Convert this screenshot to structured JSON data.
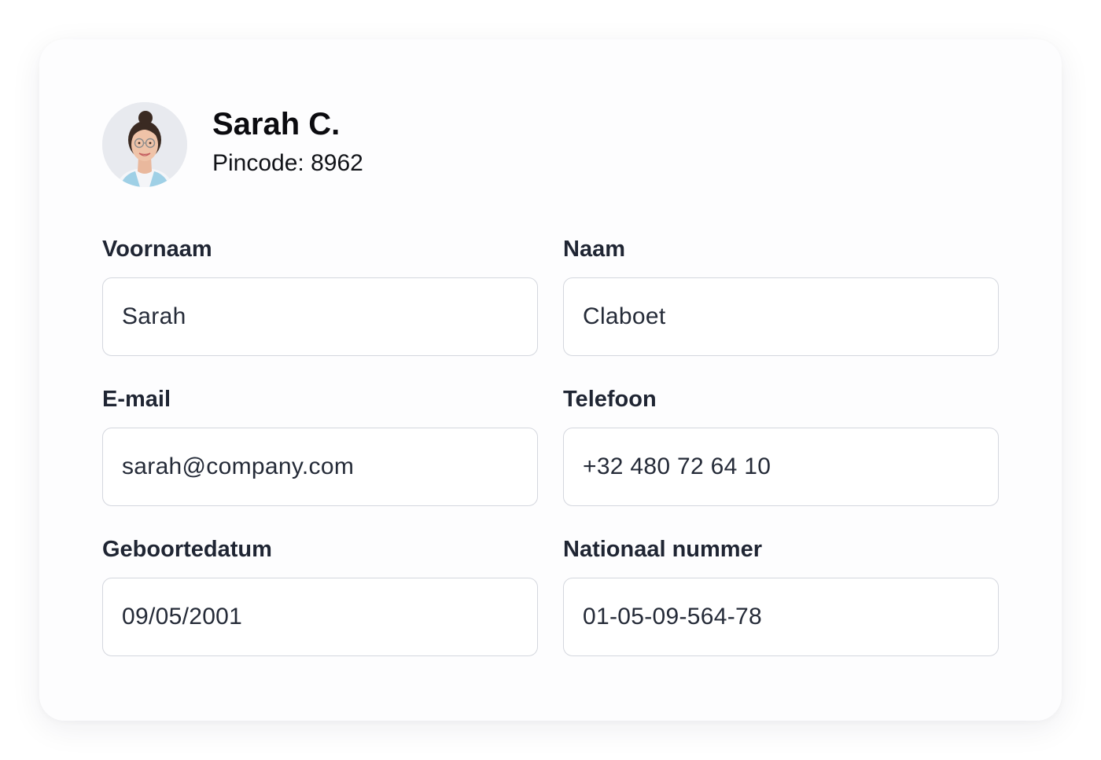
{
  "profile": {
    "name": "Sarah C.",
    "pincode_label": "Pincode: 8962",
    "avatar_icon": "user-photo"
  },
  "form": {
    "fields": [
      {
        "label": "Voornaam",
        "value": "Sarah"
      },
      {
        "label": "Naam",
        "value": "Claboet"
      },
      {
        "label": "E-mail",
        "value": "sarah@company.com"
      },
      {
        "label": "Telefoon",
        "value": "+32 480 72 64 10"
      },
      {
        "label": "Geboortedatum",
        "value": "09/05/2001"
      },
      {
        "label": "Nationaal nummer",
        "value": "01-05-09-564-78"
      }
    ]
  },
  "colors": {
    "card_background": "#fdfdfe",
    "label_text": "#1f2533",
    "input_border": "#d4d7de",
    "input_text": "#252b38"
  }
}
